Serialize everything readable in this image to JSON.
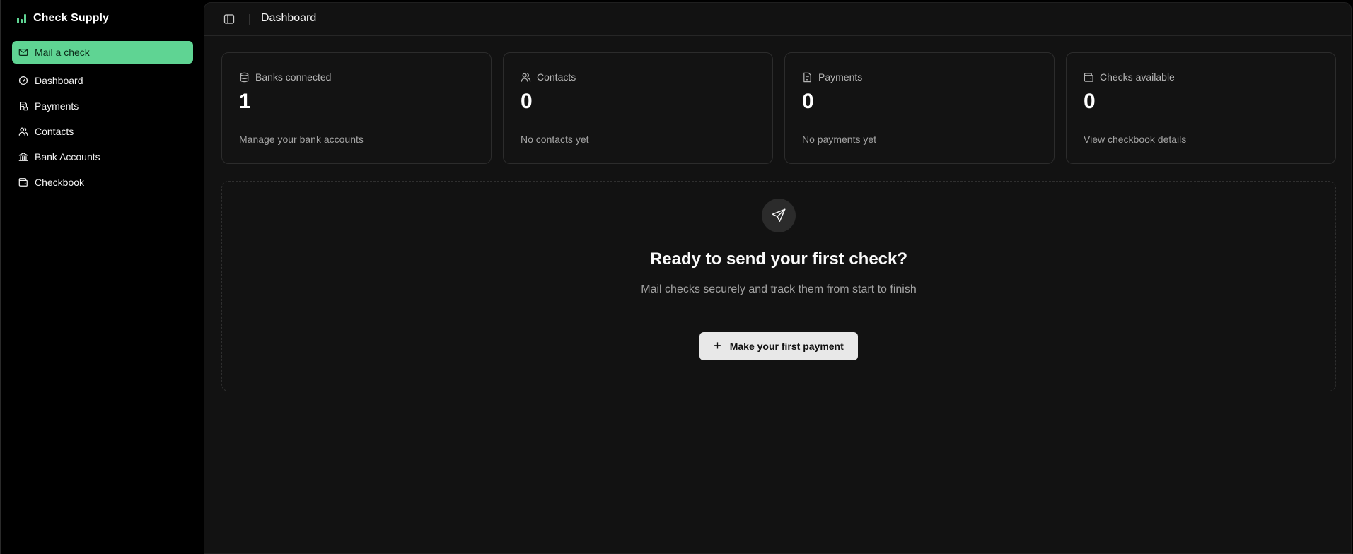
{
  "app": {
    "name": "Check Supply",
    "accent_color": "#5fd493"
  },
  "sidebar": {
    "primary_action": {
      "label": "Mail a check",
      "icon": "mail-icon"
    },
    "items": [
      {
        "label": "Dashboard",
        "icon": "gauge-icon"
      },
      {
        "label": "Payments",
        "icon": "payments-icon"
      },
      {
        "label": "Contacts",
        "icon": "users-icon"
      },
      {
        "label": "Bank Accounts",
        "icon": "bank-icon"
      },
      {
        "label": "Checkbook",
        "icon": "wallet-icon"
      }
    ]
  },
  "header": {
    "title": "Dashboard",
    "toggle_icon": "sidebar-toggle-icon"
  },
  "stats": [
    {
      "label": "Banks connected",
      "value": "1",
      "subtitle": "Manage your bank accounts",
      "icon": "database-icon"
    },
    {
      "label": "Contacts",
      "value": "0",
      "subtitle": "No contacts yet",
      "icon": "users-icon"
    },
    {
      "label": "Payments",
      "value": "0",
      "subtitle": "No payments yet",
      "icon": "file-icon"
    },
    {
      "label": "Checks available",
      "value": "0",
      "subtitle": "View checkbook details",
      "icon": "wallet-icon"
    }
  ],
  "empty_state": {
    "icon": "send-icon",
    "title": "Ready to send your first check?",
    "subtitle": "Mail checks securely and track them from start to finish",
    "button_label": "Make your first payment",
    "button_icon": "plus-icon"
  }
}
